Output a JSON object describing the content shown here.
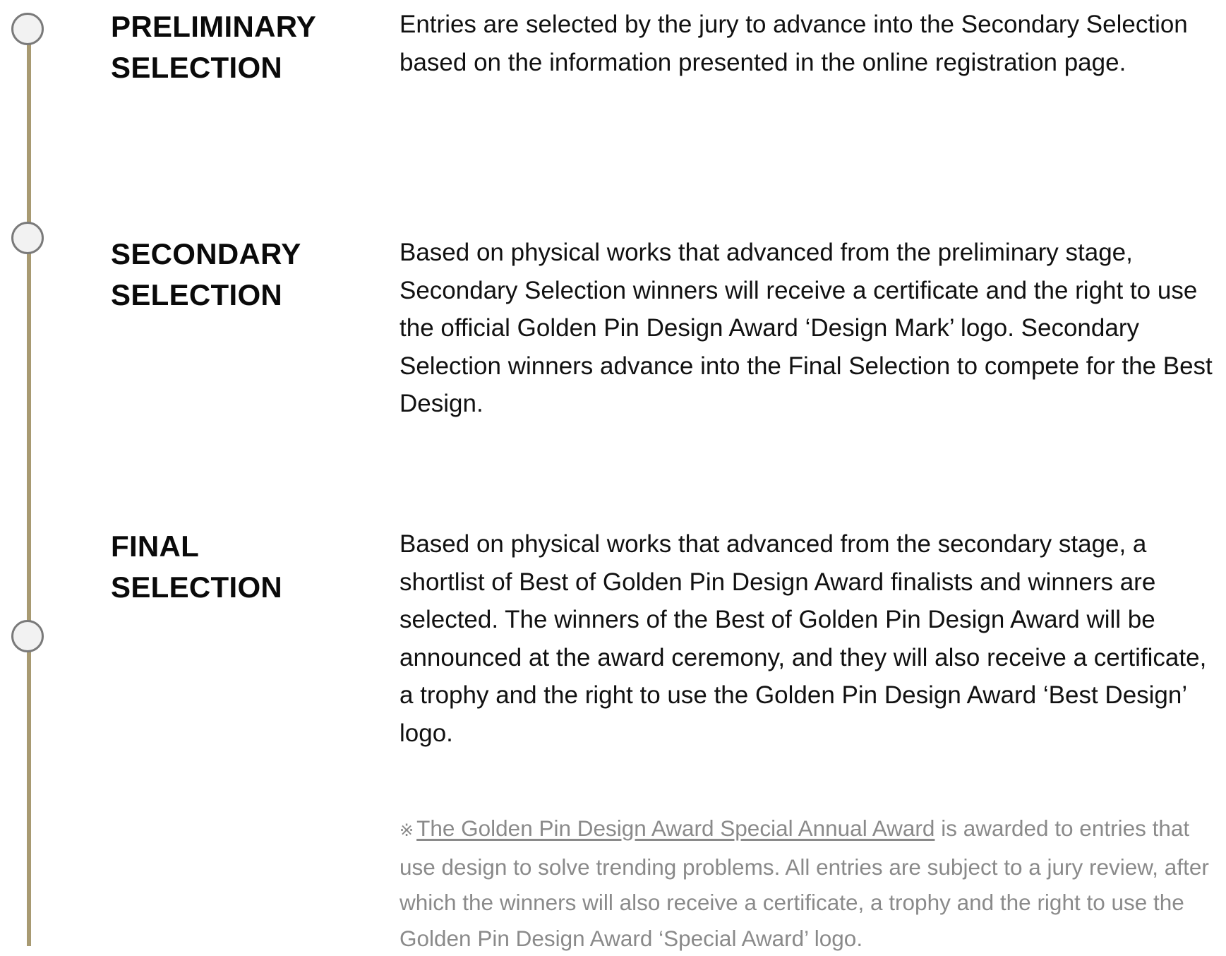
{
  "stages": [
    {
      "title_line1": "PRELIMINARY",
      "title_line2": "SELECTION",
      "description": "Entries are selected by the jury to advance into the Secondary Selection based on the information presented in the online registration page."
    },
    {
      "title_line1": "SECONDARY",
      "title_line2": "SELECTION",
      "description": "Based on physical works that advanced from the preliminary stage, Secondary Selection winners will receive a certificate and the right to use the official Golden Pin Design Award ‘Design Mark’ logo. Secondary Selection winners advance into the Final Selection to compete for the Best Design."
    },
    {
      "title_line1": "FINAL",
      "title_line2": "SELECTION",
      "description": "Based on physical works that advanced from the secondary stage, a shortlist of Best of Golden Pin Design Award finalists and winners are selected. The winners of the Best of Golden Pin Design Award will be announced at the award ceremony, and they will also receive a certificate, a trophy and the right to use the Golden Pin Design Award ‘Best Design’ logo."
    }
  ],
  "note": {
    "mark": "※",
    "link_text": "The Golden Pin Design Award Special Annual Award",
    "text": " is awarded to entries that use design to solve trending problems. All entries are subject to a jury review, after which the winners will also receive a certificate, a trophy and the right to use the Golden Pin Design Award ‘Special Award’ logo."
  },
  "colors": {
    "timeline": "#a89a72",
    "node_fill": "#f2f2f2",
    "node_border": "#7a7a7a",
    "note_text": "#8a8a8a"
  }
}
